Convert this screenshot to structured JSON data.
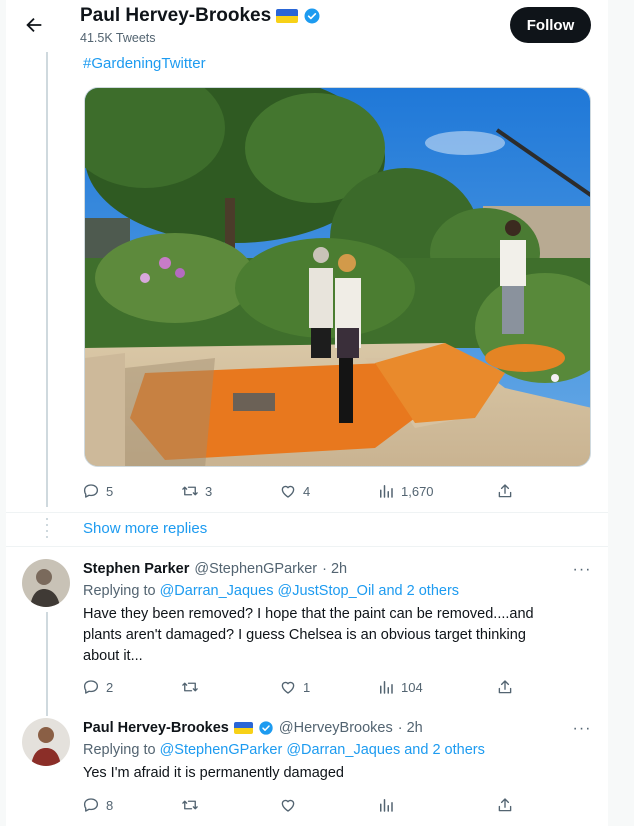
{
  "header": {
    "name": "Paul Hervey-Brookes",
    "tweets_count": "41.5K Tweets",
    "follow_label": "Follow"
  },
  "main_tweet": {
    "hashtag": "#GardeningTwitter",
    "stats": {
      "replies": "5",
      "retweets": "3",
      "likes": "4",
      "views": "1,670"
    }
  },
  "show_more_replies": "Show more replies",
  "replies": [
    {
      "name": "Stephen Parker",
      "handle": "@StephenGParker",
      "time": "· 2h",
      "replying_prefix": "Replying to",
      "replying_to": "@Darran_Jaques @JustStop_Oil and 2 others",
      "text_line1": "Have they been removed? I hope that the paint can be removed....and",
      "text_line2": "plants aren't damaged? I guess Chelsea is an obvious target thinking",
      "text_line3": "about it...",
      "stats": {
        "replies": "2",
        "retweets": "",
        "likes": "1",
        "views": "104"
      }
    },
    {
      "name": "Paul Hervey-Brookes",
      "handle": "@HerveyBrookes",
      "time": "· 2h",
      "replying_prefix": "Replying to",
      "replying_to": "@StephenGParker @Darran_Jaques and 2 others",
      "text": "Yes I'm afraid it is permanently damaged",
      "stats": {
        "replies": "8",
        "retweets": "",
        "likes": "",
        "views": ""
      }
    }
  ],
  "colors": {
    "accent": "#1d9bf0",
    "text": "#0f1419",
    "muted": "#536471",
    "orange_paint": "#e8781e"
  }
}
